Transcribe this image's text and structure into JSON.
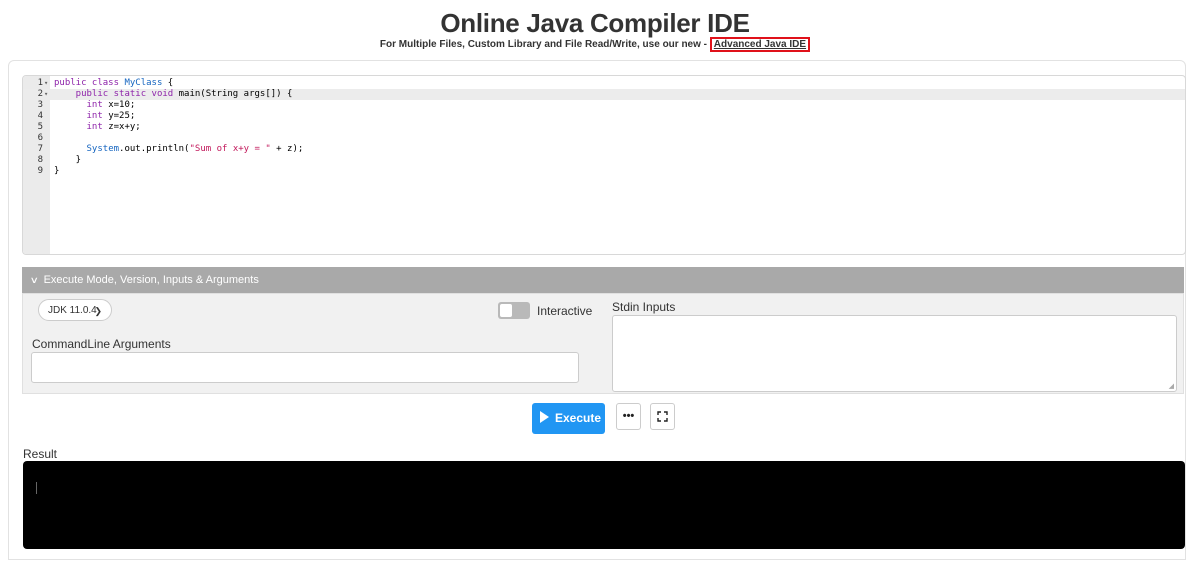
{
  "header": {
    "title": "Online Java Compiler IDE",
    "subtitle_prefix": "For Multiple Files, Custom Library and File Read/Write, use our new - ",
    "advanced_link": "Advanced Java IDE"
  },
  "editor": {
    "lines": [
      {
        "n": "1",
        "fold": "▾"
      },
      {
        "n": "2",
        "fold": "▾"
      },
      {
        "n": "3",
        "fold": ""
      },
      {
        "n": "4",
        "fold": ""
      },
      {
        "n": "5",
        "fold": ""
      },
      {
        "n": "6",
        "fold": ""
      },
      {
        "n": "7",
        "fold": ""
      },
      {
        "n": "8",
        "fold": ""
      },
      {
        "n": "9",
        "fold": ""
      }
    ],
    "code": {
      "l1_kw": "public class ",
      "l1_cls": "MyClass",
      "l1_rest": " {",
      "l2_kw": "    public static void ",
      "l2_rest": "main(String args[]) {",
      "l3_kw": "      int ",
      "l3_rest": "x=10;",
      "l4_kw": "      int ",
      "l4_rest": "y=25;",
      "l5_kw": "      int ",
      "l5_rest": "z=x+y;",
      "l7_pre": "      ",
      "l7_cls": "System",
      "l7_mid": ".out.println(",
      "l7_str": "\"Sum of x+y = \"",
      "l7_end": " + z);",
      "l8": "    }",
      "l9": "}"
    }
  },
  "options": {
    "panel_title": "Execute Mode, Version, Inputs & Arguments",
    "jdk_selected": "JDK 11.0.4",
    "interactive_label": "Interactive",
    "interactive_on": false,
    "cmd_label": "CommandLine Arguments",
    "cmd_value": "",
    "stdin_label": "Stdin Inputs",
    "stdin_value": ""
  },
  "actions": {
    "execute_label": "Execute",
    "more_icon": "ellipsis-icon",
    "fullscreen_icon": "fullscreen-icon"
  },
  "result": {
    "label": "Result",
    "output": ""
  },
  "colors": {
    "accent": "#2196f3",
    "highlight_border": "#e0111a",
    "panel_header": "#a9a9a9",
    "result_bg": "#000000"
  }
}
